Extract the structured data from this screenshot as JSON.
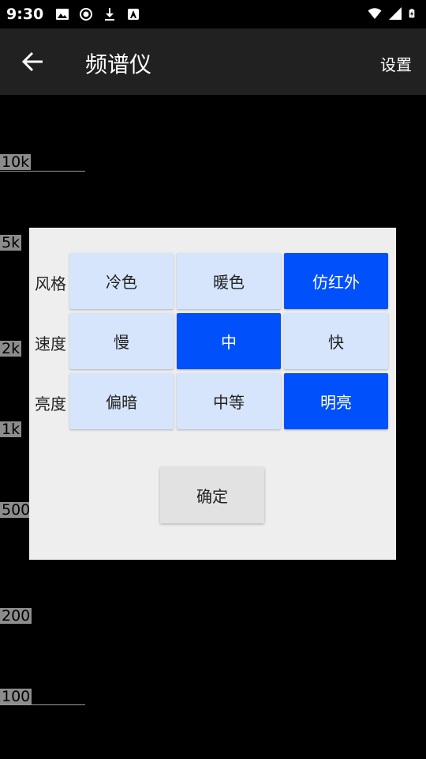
{
  "status_bar": {
    "time": "9:30"
  },
  "app_bar": {
    "title": "频谱仪",
    "settings_label": "设置"
  },
  "scale": {
    "labels": [
      "10k",
      "5k",
      "2k",
      "1k",
      "500",
      "200",
      "100"
    ]
  },
  "dialog": {
    "rows": [
      {
        "label": "风格",
        "options": [
          "冷色",
          "暖色",
          "仿红外"
        ],
        "selected": 2
      },
      {
        "label": "速度",
        "options": [
          "慢",
          "中",
          "快"
        ],
        "selected": 1
      },
      {
        "label": "亮度",
        "options": [
          "偏暗",
          "中等",
          "明亮"
        ],
        "selected": 2
      }
    ],
    "ok_label": "确定"
  },
  "colors": {
    "selected": "#0050fc",
    "option": "#d6e4fc",
    "app_bar": "#212121"
  }
}
